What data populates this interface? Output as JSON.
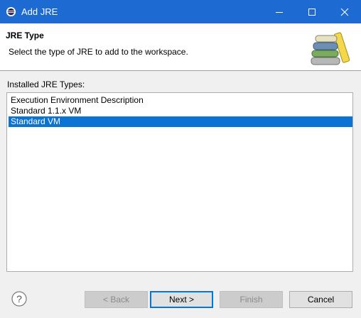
{
  "window": {
    "title": "Add JRE"
  },
  "banner": {
    "title": "JRE Type",
    "description": "Select the type of JRE to add to the workspace."
  },
  "list": {
    "label": "Installed JRE Types:",
    "items": [
      "Execution Environment Description",
      "Standard 1.1.x VM",
      "Standard VM"
    ],
    "selected": "Standard VM"
  },
  "buttons": {
    "back": "< Back",
    "next": "Next >",
    "finish": "Finish",
    "cancel": "Cancel"
  },
  "colors": {
    "titlebar": "#1d6ad3",
    "selection": "#0c73d3",
    "default_button_border": "#0078d7"
  }
}
